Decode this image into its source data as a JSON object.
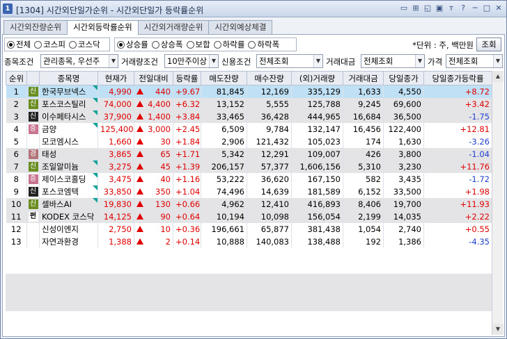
{
  "window": {
    "icon": "1",
    "title": "[1304] 시간외단일가순위 - 시간외단일가 등락률순위",
    "buttons": [
      "▭",
      "⊞",
      "◱",
      "▣",
      "ᴛ",
      "?",
      "─",
      "□",
      "✕"
    ]
  },
  "tabs": [
    {
      "label": "시간외잔량순위",
      "active": false
    },
    {
      "label": "시간외등락률순위",
      "active": true
    },
    {
      "label": "시간외거래량순위",
      "active": false
    },
    {
      "label": "시간외예상체결",
      "active": false
    }
  ],
  "market_radios": [
    {
      "label": "전체",
      "checked": true
    },
    {
      "label": "코스피",
      "checked": false
    },
    {
      "label": "코스닥",
      "checked": false
    }
  ],
  "sort_radios": [
    {
      "label": "상승률",
      "checked": true
    },
    {
      "label": "상승폭",
      "checked": false
    },
    {
      "label": "보합",
      "checked": false
    },
    {
      "label": "하락률",
      "checked": false
    },
    {
      "label": "하락폭",
      "checked": false
    }
  ],
  "unit_text": "*단위 : 주, 백만원",
  "query_button": "조회",
  "filters": {
    "stock_cond_label": "종목조건",
    "stock_cond_value": "관리종목, 우선주",
    "volume_cond_label": "거래량조건",
    "volume_cond_value": "10만주이상",
    "credit_cond_label": "신용조건",
    "credit_cond_value": "전체조회",
    "amount_label": "거래대금",
    "amount_value": "전체조회",
    "price_label": "가격",
    "price_value": "전체조회"
  },
  "columns": [
    "순위",
    "",
    "종목명",
    "현재가",
    "전일대비",
    "등락률",
    "매도잔량",
    "매수잔량",
    "(외)거래량",
    "거래대금",
    "당일종가",
    "당일종가등락률"
  ],
  "rows": [
    {
      "rank": "1",
      "badge": "신",
      "badge_type": "sin",
      "name": "한국무브넥스",
      "flag": true,
      "price": "4,990",
      "change": "440",
      "rate": "+9.67",
      "ask": "81,845",
      "bid": "12,169",
      "volume": "335,129",
      "amount": "1,633",
      "close": "4,550",
      "close_rate": "+8.72",
      "close_dir": "up"
    },
    {
      "rank": "2",
      "badge": "신",
      "badge_type": "sin",
      "name": "포스코스틸리",
      "flag": true,
      "price": "74,000",
      "change": "4,400",
      "rate": "+6.32",
      "ask": "13,152",
      "bid": "5,555",
      "volume": "125,788",
      "amount": "9,245",
      "close": "69,600",
      "close_rate": "+3.42",
      "close_dir": "up"
    },
    {
      "rank": "3",
      "badge": "신",
      "badge_type": "sin-dark",
      "name": "이수페타시스",
      "flag": true,
      "price": "37,900",
      "change": "1,400",
      "rate": "+3.84",
      "ask": "33,465",
      "bid": "36,428",
      "volume": "444,965",
      "amount": "16,684",
      "close": "36,500",
      "close_rate": "-1.75",
      "close_dir": "down"
    },
    {
      "rank": "4",
      "badge": "증",
      "badge_type": "jeung",
      "name": "금양",
      "flag": true,
      "price": "125,400",
      "change": "3,000",
      "rate": "+2.45",
      "ask": "6,509",
      "bid": "9,784",
      "volume": "132,147",
      "amount": "16,456",
      "close": "122,400",
      "close_rate": "+12.81",
      "close_dir": "up"
    },
    {
      "rank": "5",
      "badge": "",
      "badge_type": "none",
      "name": "모코엠시스",
      "flag": false,
      "price": "1,660",
      "change": "30",
      "rate": "+1.84",
      "ask": "2,906",
      "bid": "121,432",
      "volume": "105,023",
      "amount": "174",
      "close": "1,630",
      "close_rate": "-3.26",
      "close_dir": "down"
    },
    {
      "rank": "6",
      "badge": "경",
      "badge_type": "gyeong",
      "name": "태성",
      "flag": false,
      "price": "3,865",
      "change": "65",
      "rate": "+1.71",
      "ask": "5,342",
      "bid": "12,291",
      "volume": "109,007",
      "amount": "426",
      "close": "3,800",
      "close_rate": "-1.04",
      "close_dir": "down"
    },
    {
      "rank": "7",
      "badge": "신",
      "badge_type": "sin",
      "name": "조일알미늄",
      "flag": true,
      "price": "3,275",
      "change": "45",
      "rate": "+1.39",
      "ask": "206,157",
      "bid": "57,377",
      "volume": "1,606,156",
      "amount": "5,310",
      "close": "3,230",
      "close_rate": "+11.76",
      "close_dir": "up"
    },
    {
      "rank": "8",
      "badge": "증",
      "badge_type": "jeung",
      "name": "제이스코홀딩",
      "flag": true,
      "price": "3,475",
      "change": "40",
      "rate": "+1.16",
      "ask": "53,222",
      "bid": "36,620",
      "volume": "167,150",
      "amount": "582",
      "close": "3,435",
      "close_rate": "-1.72",
      "close_dir": "down"
    },
    {
      "rank": "9",
      "badge": "신",
      "badge_type": "sin-dark",
      "name": "포스코엠텍",
      "flag": true,
      "price": "33,850",
      "change": "350",
      "rate": "+1.04",
      "ask": "74,496",
      "bid": "14,639",
      "volume": "181,589",
      "amount": "6,152",
      "close": "33,500",
      "close_rate": "+1.98",
      "close_dir": "up"
    },
    {
      "rank": "10",
      "badge": "신",
      "badge_type": "sin",
      "name": "셀바스AI",
      "flag": true,
      "price": "19,830",
      "change": "130",
      "rate": "+0.66",
      "ask": "4,962",
      "bid": "12,410",
      "volume": "416,893",
      "amount": "8,406",
      "close": "19,700",
      "close_rate": "+11.93",
      "close_dir": "up"
    },
    {
      "rank": "11",
      "badge": "펀",
      "badge_type": "pyeon",
      "name": "KODEX 코스닥",
      "flag": false,
      "price": "14,125",
      "change": "90",
      "rate": "+0.64",
      "ask": "10,194",
      "bid": "10,098",
      "volume": "156,054",
      "amount": "2,199",
      "close": "14,035",
      "close_rate": "+2.22",
      "close_dir": "up"
    },
    {
      "rank": "12",
      "badge": "",
      "badge_type": "none",
      "name": "신성이엔지",
      "flag": false,
      "price": "2,750",
      "change": "10",
      "rate": "+0.36",
      "ask": "196,661",
      "bid": "65,877",
      "volume": "381,438",
      "amount": "1,054",
      "close": "2,740",
      "close_rate": "+0.55",
      "close_dir": "up"
    },
    {
      "rank": "13",
      "badge": "",
      "badge_type": "none",
      "name": "자연과환경",
      "flag": false,
      "price": "1,388",
      "change": "2",
      "rate": "+0.14",
      "ask": "10,888",
      "bid": "140,083",
      "volume": "138,488",
      "amount": "192",
      "close": "1,386",
      "close_rate": "-4.35",
      "close_dir": "down"
    }
  ],
  "colors": {
    "up": "#e00000",
    "down": "#1f3fd0",
    "selected_row": "#bfe0f5",
    "stripe": "#e4e4e6"
  }
}
